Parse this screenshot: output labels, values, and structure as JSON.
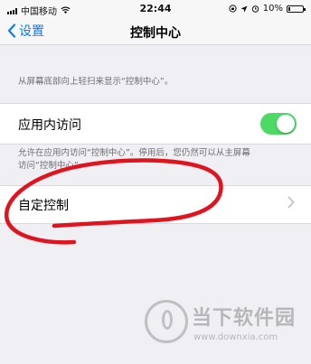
{
  "status_bar": {
    "carrier": "中国移动",
    "time": "22:44",
    "battery_percent": "10%",
    "battery_level": 0.1
  },
  "nav": {
    "back_label": "设置",
    "title": "控制中心"
  },
  "description": "从屏幕底部向上轻扫来显示“控制中心”。",
  "app_access": {
    "label": "应用内访问",
    "enabled": true,
    "footer_line1": "允许在应用内访问“控制中心”。停用后，您仍然可以从主屏幕",
    "footer_line2": "访问“控制中心”。"
  },
  "customize": {
    "label": "自定控制"
  },
  "watermark": {
    "name": "当下软件园",
    "url": "www.downxia.com"
  },
  "colors": {
    "accent": "#0a7aff",
    "toggle_on": "#4cd964",
    "annotation": "#e0141e"
  }
}
